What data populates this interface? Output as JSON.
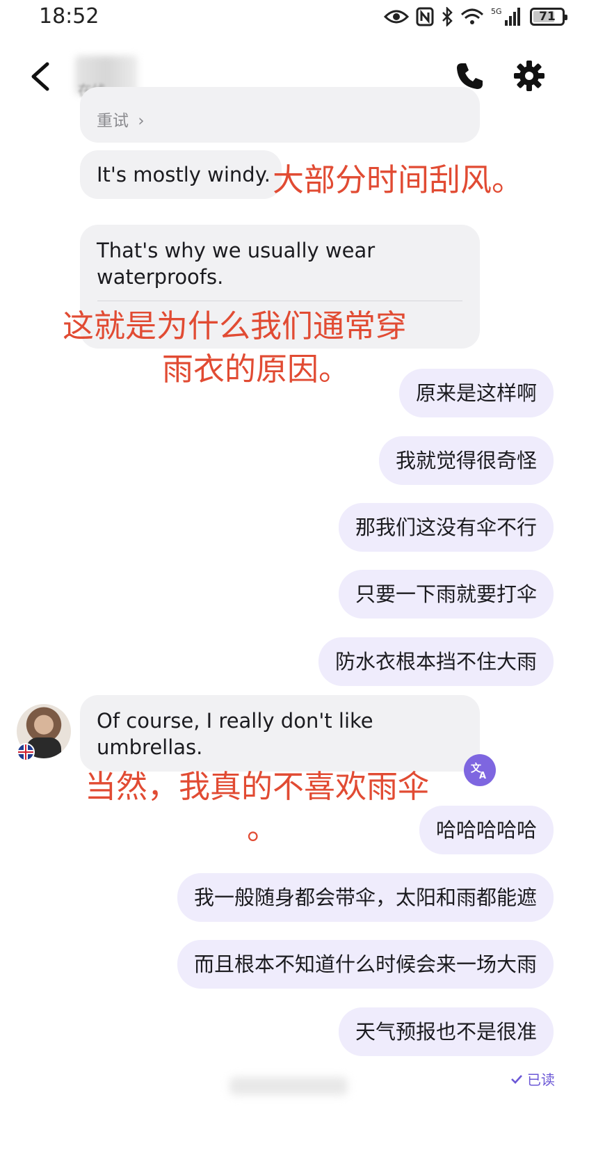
{
  "status_bar": {
    "time": "18:52",
    "battery": "71",
    "network": "5G"
  },
  "header": {
    "contact_status": "在线"
  },
  "messages": {
    "retry": "重试",
    "in1": "It's mostly windy.",
    "in1_translation": "大部分时间刮风。",
    "in2": "That's why we usually wear waterproofs.",
    "in2_translation_line1": "这就是为什么我们通常穿",
    "in2_translation_line2": "雨衣的原因。",
    "out1": "原来是这样啊",
    "out2": "我就觉得很奇怪",
    "out3": "那我们这没有伞不行",
    "out4": "只要一下雨就要打伞",
    "out5": "防水衣根本挡不住大雨",
    "in3": "Of course, I really don't like umbrellas.",
    "in3_translation_line1": "当然，我真的不喜欢雨伞",
    "in3_translation_line2": "。",
    "out6": "哈哈哈哈哈",
    "out7": "我一般随身都会带伞，太阳和雨都能遮",
    "out8": "而且根本不知道什么时候会来一场大雨",
    "out9": "天气预报也不是很准",
    "read_status": "已读"
  },
  "colors": {
    "outgoing_bubble": "#efecfc",
    "incoming_bubble": "#f1f1f3",
    "translation_text": "#e14b33",
    "accent": "#7e66e0"
  },
  "icons": [
    "back-icon",
    "phone-icon",
    "gear-icon",
    "translate-icon",
    "check-icon",
    "eye-icon",
    "nfc-icon",
    "bluetooth-icon",
    "wifi-icon",
    "signal-icon"
  ]
}
